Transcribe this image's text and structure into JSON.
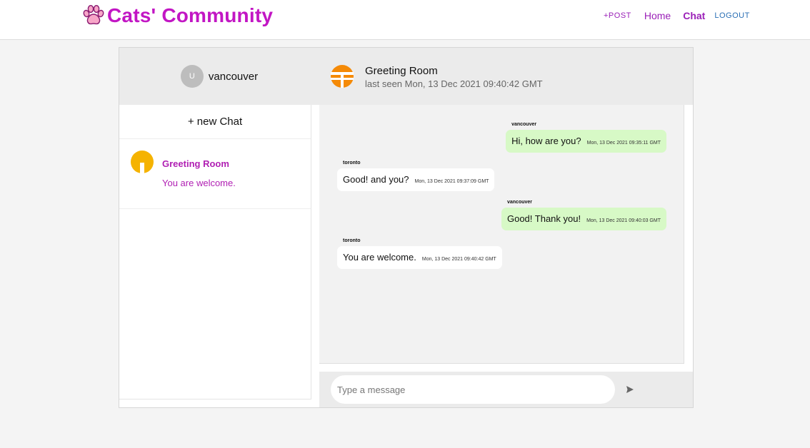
{
  "brand": {
    "title": "Cats' Community",
    "icon": "paw-icon",
    "color": "#c216c4"
  },
  "nav": {
    "post": "+POST",
    "home": "Home",
    "chat": "Chat",
    "logout": "LOGOUT"
  },
  "sidebar": {
    "user_initial": "U",
    "username": "vancouver",
    "new_chat_label": "+ new Chat",
    "rooms": [
      {
        "name": "Greeting Room",
        "last_message": "You are welcome."
      }
    ]
  },
  "room_header": {
    "name": "Greeting Room",
    "last_seen": "last seen Mon, 13 Dec 2021 09:40:42 GMT"
  },
  "messages": [
    {
      "sender": "vancouver",
      "text": "Hi, how are you?",
      "time": "Mon, 13 Dec 2021 09:35:11 GMT",
      "own": true
    },
    {
      "sender": "toronto",
      "text": "Good! and you?",
      "time": "Mon, 13 Dec 2021 09:37:09 GMT",
      "own": false
    },
    {
      "sender": "vancouver",
      "text": "Good! Thank you!",
      "time": "Mon, 13 Dec 2021 09:40:03 GMT",
      "own": true
    },
    {
      "sender": "toronto",
      "text": "You are welcome.",
      "time": "Mon, 13 Dec 2021 09:40:42 GMT",
      "own": false
    }
  ],
  "composer": {
    "placeholder": "Type a message",
    "send_icon": "send-icon"
  },
  "colors": {
    "accent": "#b01fb3",
    "own_bubble": "#d7f9c6",
    "other_bubble": "#ffffff",
    "room_logo_orange": "#f58a07",
    "room_avatar_yellow": "#f5b301"
  }
}
